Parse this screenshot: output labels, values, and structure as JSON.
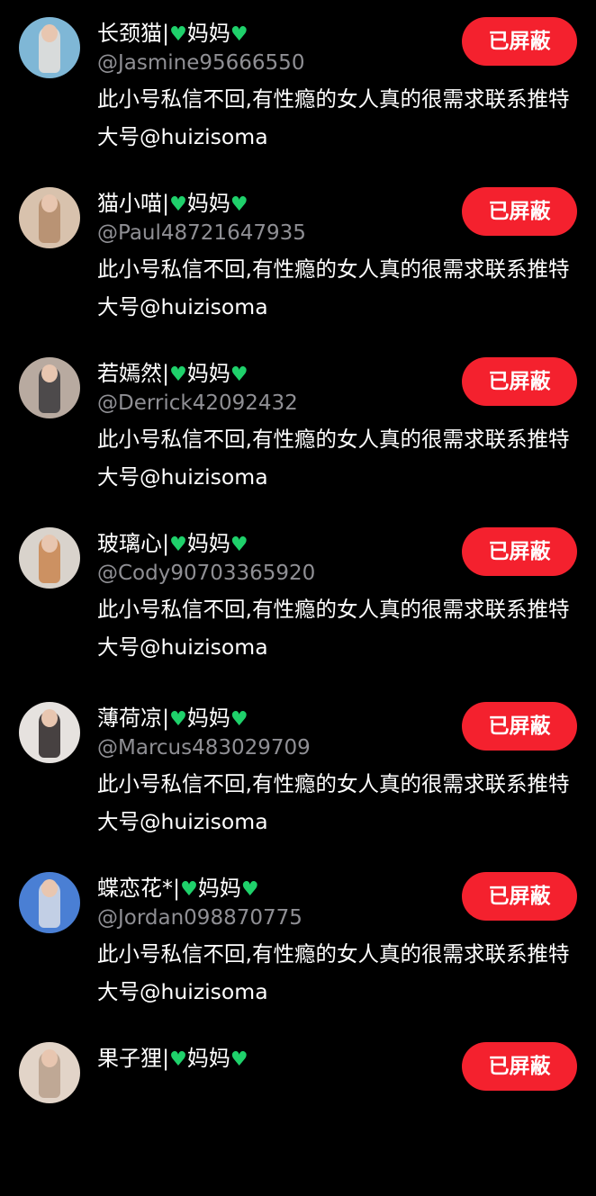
{
  "accounts": [
    {
      "name": "长颈猫|",
      "suffix": "妈妈",
      "handle": "@Jasmine95666550",
      "bio": "此小号私信不回,有性瘾的女人真的很需求联系推特大号@huizisoma",
      "button": "已屏蔽",
      "avatar_colors": [
        "#7fb7d6",
        "#e8e2dc"
      ]
    },
    {
      "name": "猫小喵|",
      "suffix": "妈妈",
      "handle": "@Paul48721647935",
      "bio": "此小号私信不回,有性瘾的女人真的很需求联系推特大号@huizisoma",
      "button": "已屏蔽",
      "avatar_colors": [
        "#d8c2ad",
        "#b48b6a"
      ]
    },
    {
      "name": "若嫣然|",
      "suffix": "妈妈",
      "handle": "@Derrick42092432",
      "bio": "此小号私信不回,有性瘾的女人真的很需求联系推特大号@huizisoma",
      "button": "已屏蔽",
      "avatar_colors": [
        "#b8aaa0",
        "#3a3a3c"
      ]
    },
    {
      "name": "玻璃心|",
      "suffix": "妈妈",
      "handle": "@Cody90703365920",
      "bio": "此小号私信不回,有性瘾的女人真的很需求联系推特大号@huizisoma",
      "button": "已屏蔽",
      "avatar_colors": [
        "#d9d3cc",
        "#c9854f"
      ]
    },
    {
      "name": "薄荷凉|",
      "suffix": "妈妈",
      "handle": "@Marcus483029709",
      "bio": "此小号私信不回,有性瘾的女人真的很需求联系推特大号@huizisoma",
      "button": "已屏蔽",
      "avatar_colors": [
        "#e6e2df",
        "#2a2426"
      ]
    },
    {
      "name": "蝶恋花*|",
      "suffix": "妈妈",
      "handle": "@Jordan098870775",
      "bio": "此小号私信不回,有性瘾的女人真的很需求联系推特大号@huizisoma",
      "button": "已屏蔽",
      "avatar_colors": [
        "#4a7fd4",
        "#d7dde8"
      ]
    },
    {
      "name": "果子狸|",
      "suffix": "妈妈",
      "handle": "",
      "bio": "",
      "button": "已屏蔽",
      "avatar_colors": [
        "#e2d4c8",
        "#b9a08c"
      ]
    }
  ],
  "icons": {
    "heart": "green-heart-icon"
  },
  "colors": {
    "background": "#000000",
    "block_button": "#f4212e",
    "handle_text": "#8f8f94",
    "heart": "#1fd16b"
  }
}
